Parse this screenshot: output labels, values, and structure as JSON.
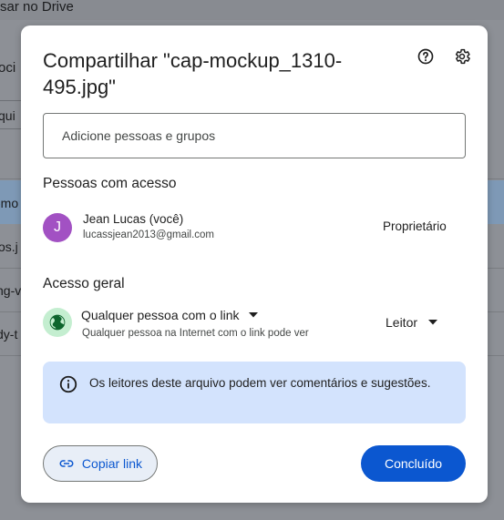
{
  "background": {
    "topbar_text": "sar no Drive",
    "fragments": [
      "oci",
      "qui",
      "-mo",
      "os.j",
      "ng-v",
      "dy-t"
    ]
  },
  "dialog": {
    "title": "Compartilhar \"cap-mockup_1310-495.jpg\"",
    "help_icon": "help-circle-icon",
    "settings_icon": "gear-icon",
    "add_people_placeholder": "Adicione pessoas e grupos",
    "people_heading": "Pessoas com acesso",
    "person": {
      "avatar_letter": "J",
      "avatar_color": "#a251c3",
      "name": "Jean Lucas (você)",
      "email": "lucassjean2013@gmail.com",
      "role": "Proprietário"
    },
    "general_access_heading": "Acesso geral",
    "general_access": {
      "icon": "globe-icon",
      "selected": "Qualquer pessoa com o link",
      "description": "Qualquer pessoa na Internet com o link pode ver",
      "role": "Leitor"
    },
    "info_banner": {
      "icon": "info-icon",
      "text": "Os leitores deste arquivo podem ver comentários e sugestões."
    },
    "copy_link_label": "Copiar link",
    "done_label": "Concluído"
  },
  "colors": {
    "primary": "#0b57d0",
    "banner": "#d3e3fd",
    "globe_bg": "#c4eed0"
  }
}
